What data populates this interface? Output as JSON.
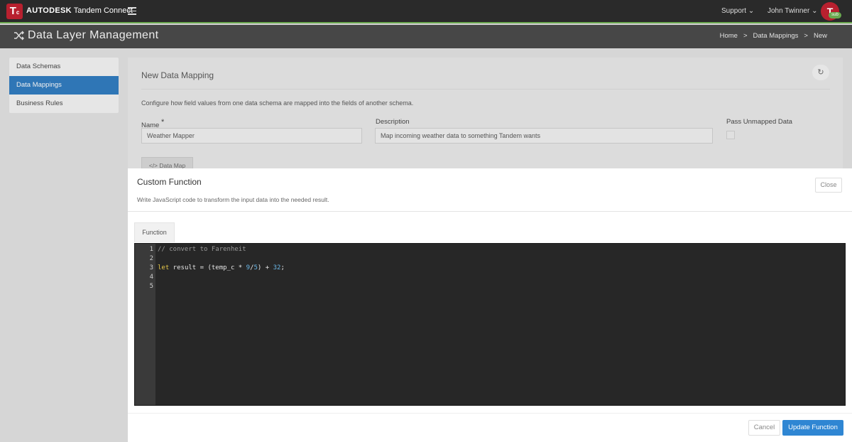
{
  "app": {
    "logo_letter": "T",
    "logo_sub": "c",
    "brand_bold": "AUTODESK",
    "brand_name": "Tandem Connect",
    "support_label": "Support",
    "user_name": "John Twinner",
    "avatar_letter": "T",
    "avatar_badge": "sub"
  },
  "header": {
    "title": "Data Layer Management",
    "breadcrumb": [
      "Home",
      "Data Mappings",
      "New"
    ],
    "breadcrumb_sep": ">"
  },
  "sidebar": {
    "items": [
      {
        "label": "Data Schemas",
        "active": false
      },
      {
        "label": "Data Mappings",
        "active": true
      },
      {
        "label": "Business Rules",
        "active": false
      }
    ]
  },
  "form": {
    "title": "New Data Mapping",
    "description_text": "Configure how field values from one data schema are mapped into the fields of another schema.",
    "name_label": "Name",
    "required_mark": "*",
    "name_value": "Weather Mapper",
    "description_label": "Description",
    "description_value": "Map incoming weather data to something Tandem wants",
    "pass_unmapped_label": "Pass Unmapped Data",
    "pass_unmapped_checked": false,
    "data_map_tab": "Data Map"
  },
  "modal": {
    "title": "Custom Function",
    "subtitle": "Write JavaScript code to transform the input data into the needed result.",
    "close_label": "Close",
    "tab_label": "Function",
    "line_numbers": [
      "1",
      "2",
      "3",
      "4",
      "5"
    ],
    "code": {
      "line1": "// convert to Farenheit",
      "kw_let": "let",
      "expr_a": " result = (temp_c * ",
      "num_9": "9",
      "slash": "/",
      "num_5": "5",
      "expr_b": ") + ",
      "num_32": "32",
      "semicolon": ";"
    },
    "cancel_label": "Cancel",
    "update_label": "Update Function"
  },
  "colors": {
    "accent": "#2f86d3",
    "nav_active": "#2f76b6",
    "brand_red": "#b8202f",
    "topbar_underline": "#6aa84f"
  }
}
